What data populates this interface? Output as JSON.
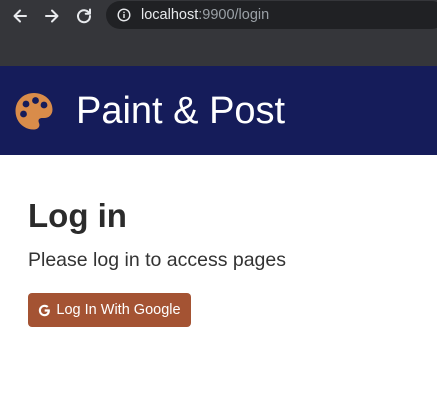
{
  "browser": {
    "url_host": "localhost",
    "url_path": ":9900/login",
    "icons": {
      "back": "arrow-left-icon",
      "forward": "arrow-right-icon",
      "reload": "reload-icon",
      "site_info": "info-icon"
    }
  },
  "header": {
    "title": "Paint & Post",
    "logo_icon": "palette-icon",
    "background_color": "#151c5a"
  },
  "main": {
    "heading": "Log in",
    "subtitle": "Please log in to access pages",
    "login_button": {
      "label": "Log In With Google",
      "icon": "google-icon",
      "color": "#a45333"
    }
  }
}
